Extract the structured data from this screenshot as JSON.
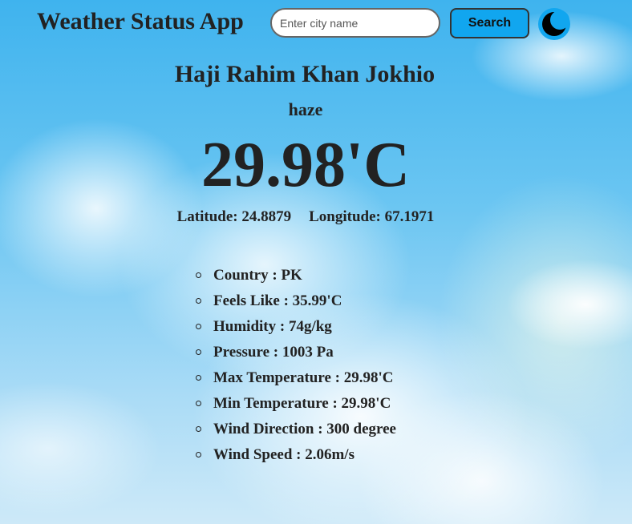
{
  "header": {
    "title": "Weather Status App",
    "search_placeholder": "Enter city name",
    "search_value": "",
    "search_label": "Search",
    "theme_icon": "moon-icon"
  },
  "weather": {
    "city": "Haji Rahim Khan Jokhio",
    "condition": "haze",
    "temperature": "29.98'C",
    "latitude": "Latitude: 24.8879",
    "longitude": "Longitude: 67.1971"
  },
  "details": [
    "Country : PK",
    "Feels Like : 35.99'C",
    "Humidity : 74g/kg",
    "Pressure : 1003 Pa",
    "Max Temperature : 29.98'C",
    "Min Temperature : 29.98'C",
    "Wind Direction : 300 degree",
    "Wind Speed : 2.06m/s"
  ],
  "colors": {
    "accent": "#11a6ef",
    "sky": "#3fb3ee",
    "text": "#222222"
  }
}
